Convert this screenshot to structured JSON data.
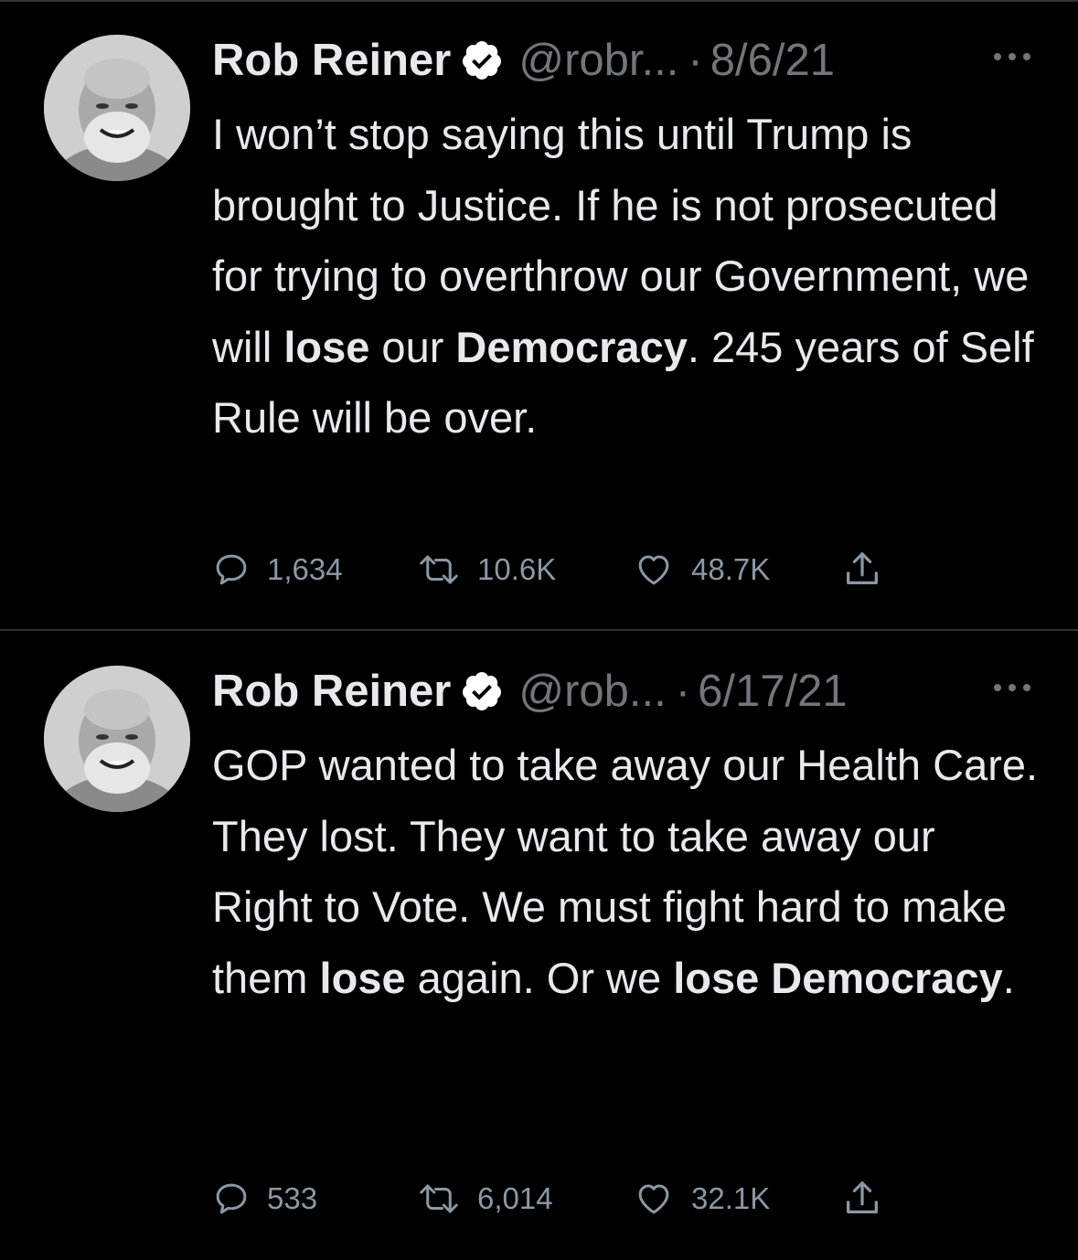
{
  "colors": {
    "background": "#000000",
    "divider": "#2f3336",
    "text_primary": "#e7e9ea",
    "text_secondary": "#71767b",
    "verified_badge": "#ffffff"
  },
  "tweets": [
    {
      "author_name": "Rob Reiner",
      "verified_icon": "verified-badge-icon",
      "handle": "@robr...",
      "separator": "·",
      "date": "8/6/21",
      "body": {
        "p1": "I won’t stop saying this until Trump is brought to Justice. If he is not prosecuted for trying to overthrow our Government, we will ",
        "b1": "lose",
        "p2": " our ",
        "b2": "Democracy",
        "p3": ". 245 years of Self Rule will be over."
      },
      "replies": "1,634",
      "retweets": "10.6K",
      "likes": "48.7K"
    },
    {
      "author_name": "Rob Reiner",
      "verified_icon": "verified-badge-icon",
      "handle": "@rob...",
      "separator": "·",
      "date": "6/17/21",
      "body": {
        "p1": "GOP wanted to take away our Health Care. They lost. They want to take away our Right to Vote. We must fight hard to make them ",
        "b1": "lose",
        "p2": " again. Or we ",
        "b2": "lose",
        "p3": " ",
        "b3": "Democracy",
        "p4": "."
      },
      "replies": "533",
      "retweets": "6,014",
      "likes": "32.1K"
    }
  ]
}
